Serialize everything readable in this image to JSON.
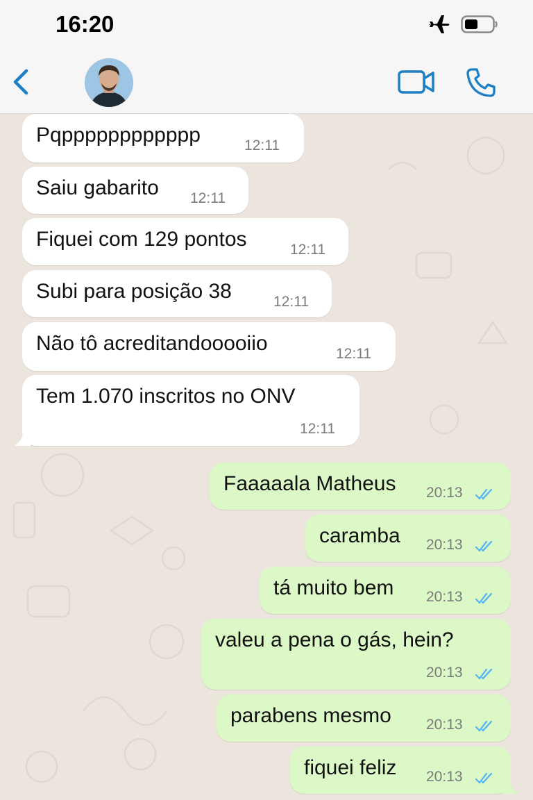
{
  "status_bar": {
    "time": "16:20",
    "icons": [
      "airplane-icon",
      "battery-icon"
    ]
  },
  "header": {
    "back_icon": "chevron-left-icon",
    "contact_avatar": "avatar",
    "actions": [
      "video-call-icon",
      "phone-icon"
    ]
  },
  "colors": {
    "accent": "#1d7fc4",
    "incoming_bubble": "#ffffff",
    "outgoing_bubble": "#dcf8c6",
    "read_ticks": "#4fb3f6",
    "chat_background": "#ece5dd"
  },
  "messages": [
    {
      "direction": "in",
      "text": "Pqpppppppppppp",
      "time": "12:11"
    },
    {
      "direction": "in",
      "text": "Saiu gabarito",
      "time": "12:11"
    },
    {
      "direction": "in",
      "text": "Fiquei com 129 pontos",
      "time": "12:11"
    },
    {
      "direction": "in",
      "text": "Subi para posição 38",
      "time": "12:11"
    },
    {
      "direction": "in",
      "text": "Não tô acreditandooooiio",
      "time": "12:11"
    },
    {
      "direction": "in",
      "text": "Tem 1.070 inscritos no ONV",
      "time": "12:11"
    },
    {
      "direction": "out",
      "text": "Faaaaala Matheus",
      "time": "20:13",
      "status": "read"
    },
    {
      "direction": "out",
      "text": "caramba",
      "time": "20:13",
      "status": "read"
    },
    {
      "direction": "out",
      "text": "tá muito bem",
      "time": "20:13",
      "status": "read"
    },
    {
      "direction": "out",
      "text": "valeu a pena o gás, hein?",
      "time": "20:13",
      "status": "read"
    },
    {
      "direction": "out",
      "text": "parabens mesmo",
      "time": "20:13",
      "status": "read"
    },
    {
      "direction": "out",
      "text": "fiquei feliz",
      "time": "20:13",
      "status": "read"
    }
  ]
}
